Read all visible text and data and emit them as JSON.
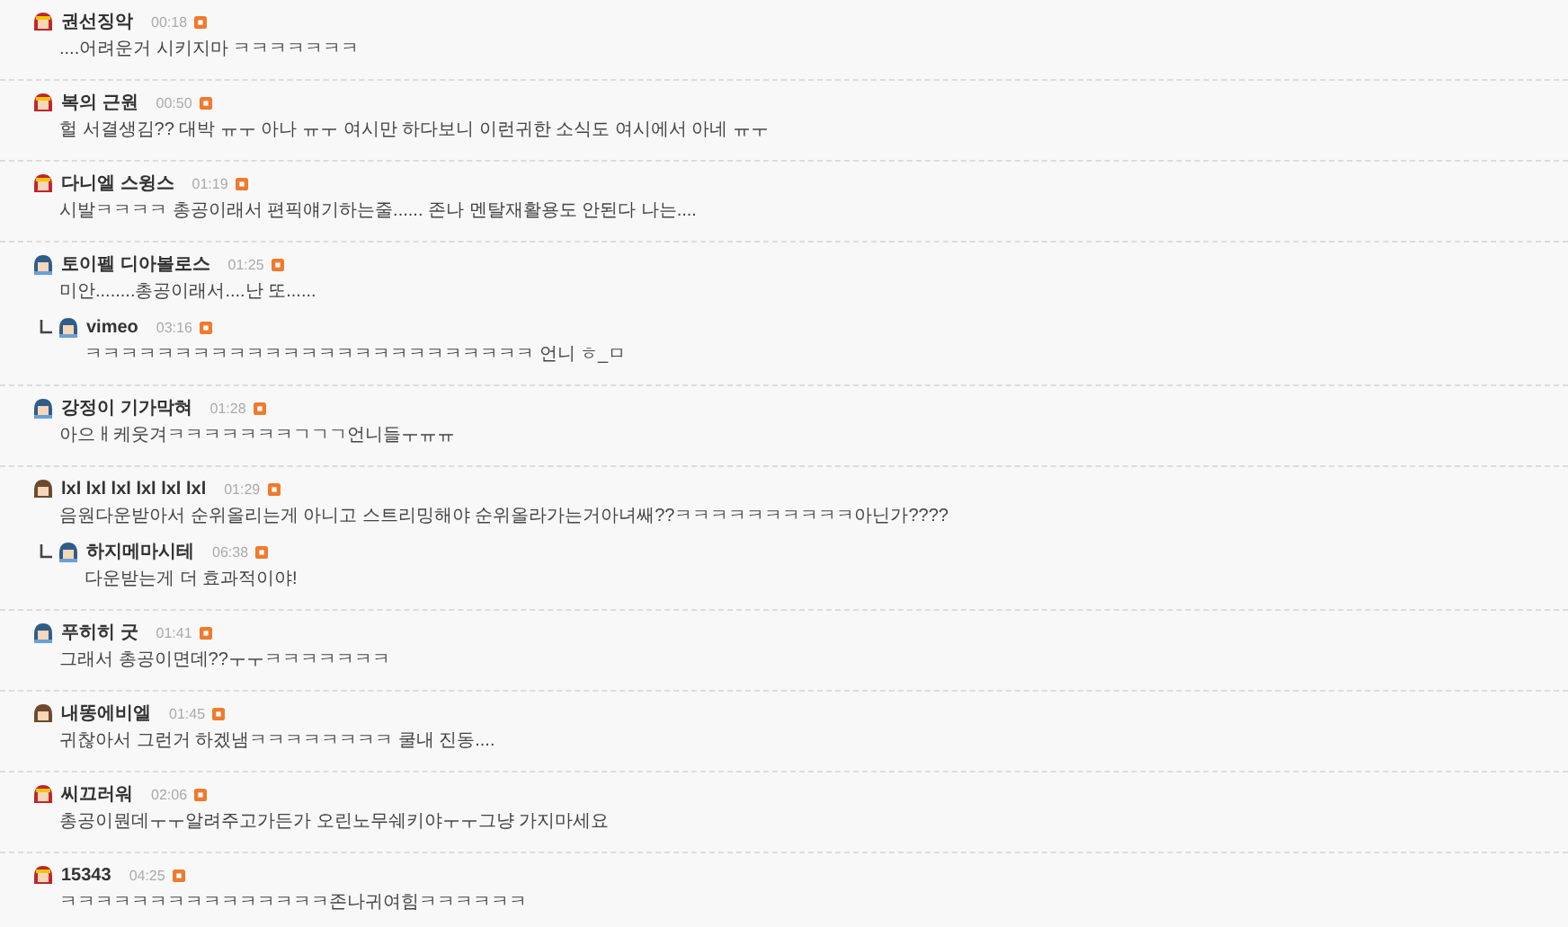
{
  "comments": [
    {
      "kind": "red",
      "nickname": "권선징악",
      "time": "00:18",
      "is_new": true,
      "text": "....어려운거 시키지마 ㅋㅋㅋㅋㅋㅋㅋ"
    },
    {
      "kind": "red",
      "nickname": "복의 근원",
      "time": "00:50",
      "is_new": true,
      "text": "헐 서결생김?? 대박 ㅠㅜ 아나 ㅠㅜ 여시만 하다보니 이런귀한 소식도 여시에서 아네 ㅠㅜ"
    },
    {
      "kind": "red",
      "nickname": "다니엘 스윙스",
      "time": "01:19",
      "is_new": true,
      "text": "시발ㅋㅋㅋㅋ 총공이래서 편픽얘기하는줄...... 존나 멘탈재활용도 안된다 나는...."
    },
    {
      "kind": "blue",
      "nickname": "토이펠 디아볼로스",
      "time": "01:25",
      "is_new": true,
      "text": "미안........총공이래서....난 또......",
      "children": [
        {
          "kind": "blue",
          "nickname": "vimeo",
          "time": "03:16",
          "is_new": true,
          "text": "ㅋㅋㅋㅋㅋㅋㅋㅋㅋㅋㅋㅋㅋㅋㅋㅋㅋㅋㅋㅋㅋㅋㅋㅋㅋ 언니 ㅎ_ㅁ"
        }
      ]
    },
    {
      "kind": "blue",
      "nickname": "강정이 기가막혀",
      "time": "01:28",
      "is_new": true,
      "text": "아으ㅐ케웃겨ㅋㅋㅋㅋㅋㅋㅋㄱㄱㄱ언니들ㅜㅠㅠ"
    },
    {
      "kind": "girl",
      "nickname": "lxl lxl lxl lxl lxl lxl",
      "time": "01:29",
      "is_new": true,
      "text": "음원다운받아서 순위올리는게 아니고 스트리밍해야 순위올라가는거아녀쌔??ㅋㅋㅋㅋㅋㅋㅋㅋㅋㅋ아닌가????",
      "children": [
        {
          "kind": "blue",
          "nickname": "하지메마시테",
          "time": "06:38",
          "is_new": true,
          "text": "다운받는게 더 효과적이야!"
        }
      ]
    },
    {
      "kind": "blue",
      "nickname": "푸히히 굿",
      "time": "01:41",
      "is_new": true,
      "text": "그래서 총공이면데??ㅜㅜㅋㅋㅋㅋㅋㅋㅋ"
    },
    {
      "kind": "girl",
      "nickname": "내똥에비엘",
      "time": "01:45",
      "is_new": true,
      "text": "귀찮아서 그런거 하겠냄ㅋㅋㅋㅋㅋㅋㅋㅋ 쿨내 진동...."
    },
    {
      "kind": "red",
      "nickname": "씨끄러워",
      "time": "02:06",
      "is_new": true,
      "text": "총공이뭔데ㅜㅜ알려주고가든가 오린노무쉐키야ㅜㅜ그냥 가지마세요"
    },
    {
      "kind": "red",
      "nickname": "15343",
      "time": "04:25",
      "is_new": true,
      "text": "ㅋㅋㅋㅋㅋㅋㅋㅋㅋㅋㅋㅋㅋㅋㅋ존나귀여힘ㅋㅋㅋㅋㅋㅋ"
    }
  ]
}
